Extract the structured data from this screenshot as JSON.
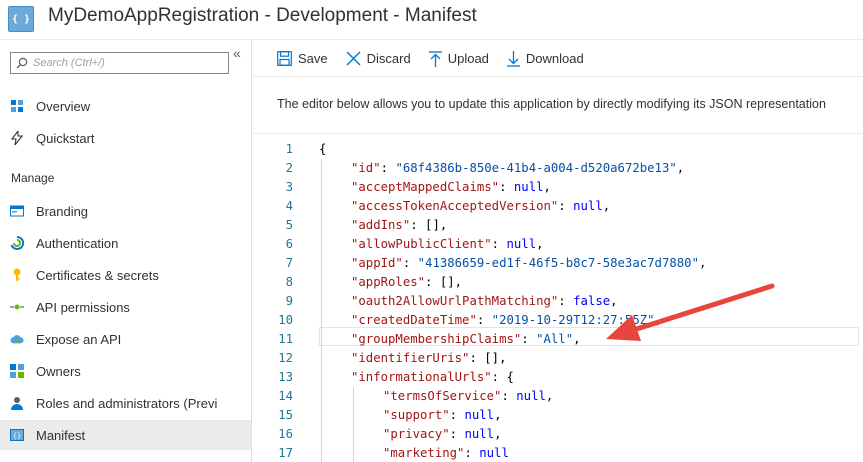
{
  "window": {
    "title": "MyDemoAppRegistration - Development - Manifest",
    "icon_glyph": "{ }"
  },
  "sidebar": {
    "search_placeholder": "Search (Ctrl+/)",
    "collapse_glyph": "«",
    "items_top": [
      {
        "label": "Overview",
        "icon": "overview-icon"
      },
      {
        "label": "Quickstart",
        "icon": "quickstart-icon"
      }
    ],
    "manage_label": "Manage",
    "items_manage": [
      {
        "label": "Branding",
        "icon": "branding-icon"
      },
      {
        "label": "Authentication",
        "icon": "authentication-icon"
      },
      {
        "label": "Certificates & secrets",
        "icon": "key-icon"
      },
      {
        "label": "API permissions",
        "icon": "api-permissions-icon"
      },
      {
        "label": "Expose an API",
        "icon": "cloud-icon"
      },
      {
        "label": "Owners",
        "icon": "owners-icon"
      },
      {
        "label": "Roles and administrators (Previ",
        "icon": "roles-icon"
      },
      {
        "label": "Manifest",
        "icon": "manifest-icon",
        "active": true
      }
    ]
  },
  "toolbar": {
    "save": "Save",
    "discard": "Discard",
    "upload": "Upload",
    "download": "Download"
  },
  "description": "The editor below allows you to update this application by directly modifying its JSON representation",
  "editor": {
    "lines": [
      {
        "num": "1",
        "indent": 0,
        "tokens": [
          [
            "p",
            "{"
          ]
        ]
      },
      {
        "num": "2",
        "indent": 1,
        "tokens": [
          [
            "k",
            "\"id\""
          ],
          [
            "p",
            ": "
          ],
          [
            "s",
            "\"68f4386b-850e-41b4-a004-d520a672be13\""
          ],
          [
            "p",
            ","
          ]
        ]
      },
      {
        "num": "3",
        "indent": 1,
        "tokens": [
          [
            "k",
            "\"acceptMappedClaims\""
          ],
          [
            "p",
            ": "
          ],
          [
            "n",
            "null"
          ],
          [
            "p",
            ","
          ]
        ]
      },
      {
        "num": "4",
        "indent": 1,
        "tokens": [
          [
            "k",
            "\"accessTokenAcceptedVersion\""
          ],
          [
            "p",
            ": "
          ],
          [
            "n",
            "null"
          ],
          [
            "p",
            ","
          ]
        ]
      },
      {
        "num": "5",
        "indent": 1,
        "tokens": [
          [
            "k",
            "\"addIns\""
          ],
          [
            "p",
            ": [],"
          ]
        ]
      },
      {
        "num": "6",
        "indent": 1,
        "tokens": [
          [
            "k",
            "\"allowPublicClient\""
          ],
          [
            "p",
            ": "
          ],
          [
            "n",
            "null"
          ],
          [
            "p",
            ","
          ]
        ]
      },
      {
        "num": "7",
        "indent": 1,
        "tokens": [
          [
            "k",
            "\"appId\""
          ],
          [
            "p",
            ": "
          ],
          [
            "s",
            "\"41386659-ed1f-46f5-b8c7-58e3ac7d7880\""
          ],
          [
            "p",
            ","
          ]
        ]
      },
      {
        "num": "8",
        "indent": 1,
        "tokens": [
          [
            "k",
            "\"appRoles\""
          ],
          [
            "p",
            ": [],"
          ]
        ]
      },
      {
        "num": "9",
        "indent": 1,
        "tokens": [
          [
            "k",
            "\"oauth2AllowUrlPathMatching\""
          ],
          [
            "p",
            ": "
          ],
          [
            "n",
            "false"
          ],
          [
            "p",
            ","
          ]
        ]
      },
      {
        "num": "10",
        "indent": 1,
        "tokens": [
          [
            "k",
            "\"createdDateTime\""
          ],
          [
            "p",
            ": "
          ],
          [
            "s",
            "\"2019-10-29T12:27:55Z\""
          ],
          [
            "p",
            ","
          ]
        ]
      },
      {
        "num": "11",
        "indent": 1,
        "tokens": [
          [
            "k",
            "\"groupMembershipClaims\""
          ],
          [
            "p",
            ": "
          ],
          [
            "s",
            "\"All\""
          ],
          [
            "p",
            ","
          ]
        ]
      },
      {
        "num": "12",
        "indent": 1,
        "tokens": [
          [
            "k",
            "\"identifierUris\""
          ],
          [
            "p",
            ": [],"
          ]
        ]
      },
      {
        "num": "13",
        "indent": 1,
        "tokens": [
          [
            "k",
            "\"informationalUrls\""
          ],
          [
            "p",
            ": {"
          ]
        ]
      },
      {
        "num": "14",
        "indent": 2,
        "tokens": [
          [
            "k",
            "\"termsOfService\""
          ],
          [
            "p",
            ": "
          ],
          [
            "n",
            "null"
          ],
          [
            "p",
            ","
          ]
        ]
      },
      {
        "num": "15",
        "indent": 2,
        "tokens": [
          [
            "k",
            "\"support\""
          ],
          [
            "p",
            ": "
          ],
          [
            "n",
            "null"
          ],
          [
            "p",
            ","
          ]
        ]
      },
      {
        "num": "16",
        "indent": 2,
        "tokens": [
          [
            "k",
            "\"privacy\""
          ],
          [
            "p",
            ": "
          ],
          [
            "n",
            "null"
          ],
          [
            "p",
            ","
          ]
        ]
      },
      {
        "num": "17",
        "indent": 2,
        "tokens": [
          [
            "k",
            "\"marketing\""
          ],
          [
            "p",
            ": "
          ],
          [
            "n",
            "null"
          ]
        ]
      }
    ]
  },
  "colors": {
    "accent": "#0078d4",
    "arrow": "#e8453c",
    "key": "#a31515",
    "string": "#0451a5",
    "literal": "#0000ff",
    "line_number": "#237893"
  }
}
